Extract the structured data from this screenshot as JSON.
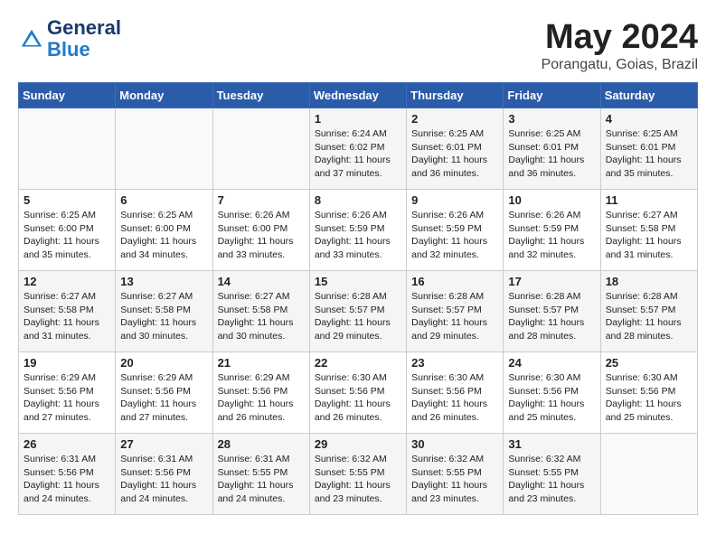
{
  "header": {
    "logo_line1": "General",
    "logo_line2": "Blue",
    "month": "May 2024",
    "location": "Porangatu, Goias, Brazil"
  },
  "weekdays": [
    "Sunday",
    "Monday",
    "Tuesday",
    "Wednesday",
    "Thursday",
    "Friday",
    "Saturday"
  ],
  "weeks": [
    [
      {
        "day": "",
        "info": ""
      },
      {
        "day": "",
        "info": ""
      },
      {
        "day": "",
        "info": ""
      },
      {
        "day": "1",
        "info": "Sunrise: 6:24 AM\nSunset: 6:02 PM\nDaylight: 11 hours and 37 minutes."
      },
      {
        "day": "2",
        "info": "Sunrise: 6:25 AM\nSunset: 6:01 PM\nDaylight: 11 hours and 36 minutes."
      },
      {
        "day": "3",
        "info": "Sunrise: 6:25 AM\nSunset: 6:01 PM\nDaylight: 11 hours and 36 minutes."
      },
      {
        "day": "4",
        "info": "Sunrise: 6:25 AM\nSunset: 6:01 PM\nDaylight: 11 hours and 35 minutes."
      }
    ],
    [
      {
        "day": "5",
        "info": "Sunrise: 6:25 AM\nSunset: 6:00 PM\nDaylight: 11 hours and 35 minutes."
      },
      {
        "day": "6",
        "info": "Sunrise: 6:25 AM\nSunset: 6:00 PM\nDaylight: 11 hours and 34 minutes."
      },
      {
        "day": "7",
        "info": "Sunrise: 6:26 AM\nSunset: 6:00 PM\nDaylight: 11 hours and 33 minutes."
      },
      {
        "day": "8",
        "info": "Sunrise: 6:26 AM\nSunset: 5:59 PM\nDaylight: 11 hours and 33 minutes."
      },
      {
        "day": "9",
        "info": "Sunrise: 6:26 AM\nSunset: 5:59 PM\nDaylight: 11 hours and 32 minutes."
      },
      {
        "day": "10",
        "info": "Sunrise: 6:26 AM\nSunset: 5:59 PM\nDaylight: 11 hours and 32 minutes."
      },
      {
        "day": "11",
        "info": "Sunrise: 6:27 AM\nSunset: 5:58 PM\nDaylight: 11 hours and 31 minutes."
      }
    ],
    [
      {
        "day": "12",
        "info": "Sunrise: 6:27 AM\nSunset: 5:58 PM\nDaylight: 11 hours and 31 minutes."
      },
      {
        "day": "13",
        "info": "Sunrise: 6:27 AM\nSunset: 5:58 PM\nDaylight: 11 hours and 30 minutes."
      },
      {
        "day": "14",
        "info": "Sunrise: 6:27 AM\nSunset: 5:58 PM\nDaylight: 11 hours and 30 minutes."
      },
      {
        "day": "15",
        "info": "Sunrise: 6:28 AM\nSunset: 5:57 PM\nDaylight: 11 hours and 29 minutes."
      },
      {
        "day": "16",
        "info": "Sunrise: 6:28 AM\nSunset: 5:57 PM\nDaylight: 11 hours and 29 minutes."
      },
      {
        "day": "17",
        "info": "Sunrise: 6:28 AM\nSunset: 5:57 PM\nDaylight: 11 hours and 28 minutes."
      },
      {
        "day": "18",
        "info": "Sunrise: 6:28 AM\nSunset: 5:57 PM\nDaylight: 11 hours and 28 minutes."
      }
    ],
    [
      {
        "day": "19",
        "info": "Sunrise: 6:29 AM\nSunset: 5:56 PM\nDaylight: 11 hours and 27 minutes."
      },
      {
        "day": "20",
        "info": "Sunrise: 6:29 AM\nSunset: 5:56 PM\nDaylight: 11 hours and 27 minutes."
      },
      {
        "day": "21",
        "info": "Sunrise: 6:29 AM\nSunset: 5:56 PM\nDaylight: 11 hours and 26 minutes."
      },
      {
        "day": "22",
        "info": "Sunrise: 6:30 AM\nSunset: 5:56 PM\nDaylight: 11 hours and 26 minutes."
      },
      {
        "day": "23",
        "info": "Sunrise: 6:30 AM\nSunset: 5:56 PM\nDaylight: 11 hours and 26 minutes."
      },
      {
        "day": "24",
        "info": "Sunrise: 6:30 AM\nSunset: 5:56 PM\nDaylight: 11 hours and 25 minutes."
      },
      {
        "day": "25",
        "info": "Sunrise: 6:30 AM\nSunset: 5:56 PM\nDaylight: 11 hours and 25 minutes."
      }
    ],
    [
      {
        "day": "26",
        "info": "Sunrise: 6:31 AM\nSunset: 5:56 PM\nDaylight: 11 hours and 24 minutes."
      },
      {
        "day": "27",
        "info": "Sunrise: 6:31 AM\nSunset: 5:56 PM\nDaylight: 11 hours and 24 minutes."
      },
      {
        "day": "28",
        "info": "Sunrise: 6:31 AM\nSunset: 5:55 PM\nDaylight: 11 hours and 24 minutes."
      },
      {
        "day": "29",
        "info": "Sunrise: 6:32 AM\nSunset: 5:55 PM\nDaylight: 11 hours and 23 minutes."
      },
      {
        "day": "30",
        "info": "Sunrise: 6:32 AM\nSunset: 5:55 PM\nDaylight: 11 hours and 23 minutes."
      },
      {
        "day": "31",
        "info": "Sunrise: 6:32 AM\nSunset: 5:55 PM\nDaylight: 11 hours and 23 minutes."
      },
      {
        "day": "",
        "info": ""
      }
    ]
  ]
}
